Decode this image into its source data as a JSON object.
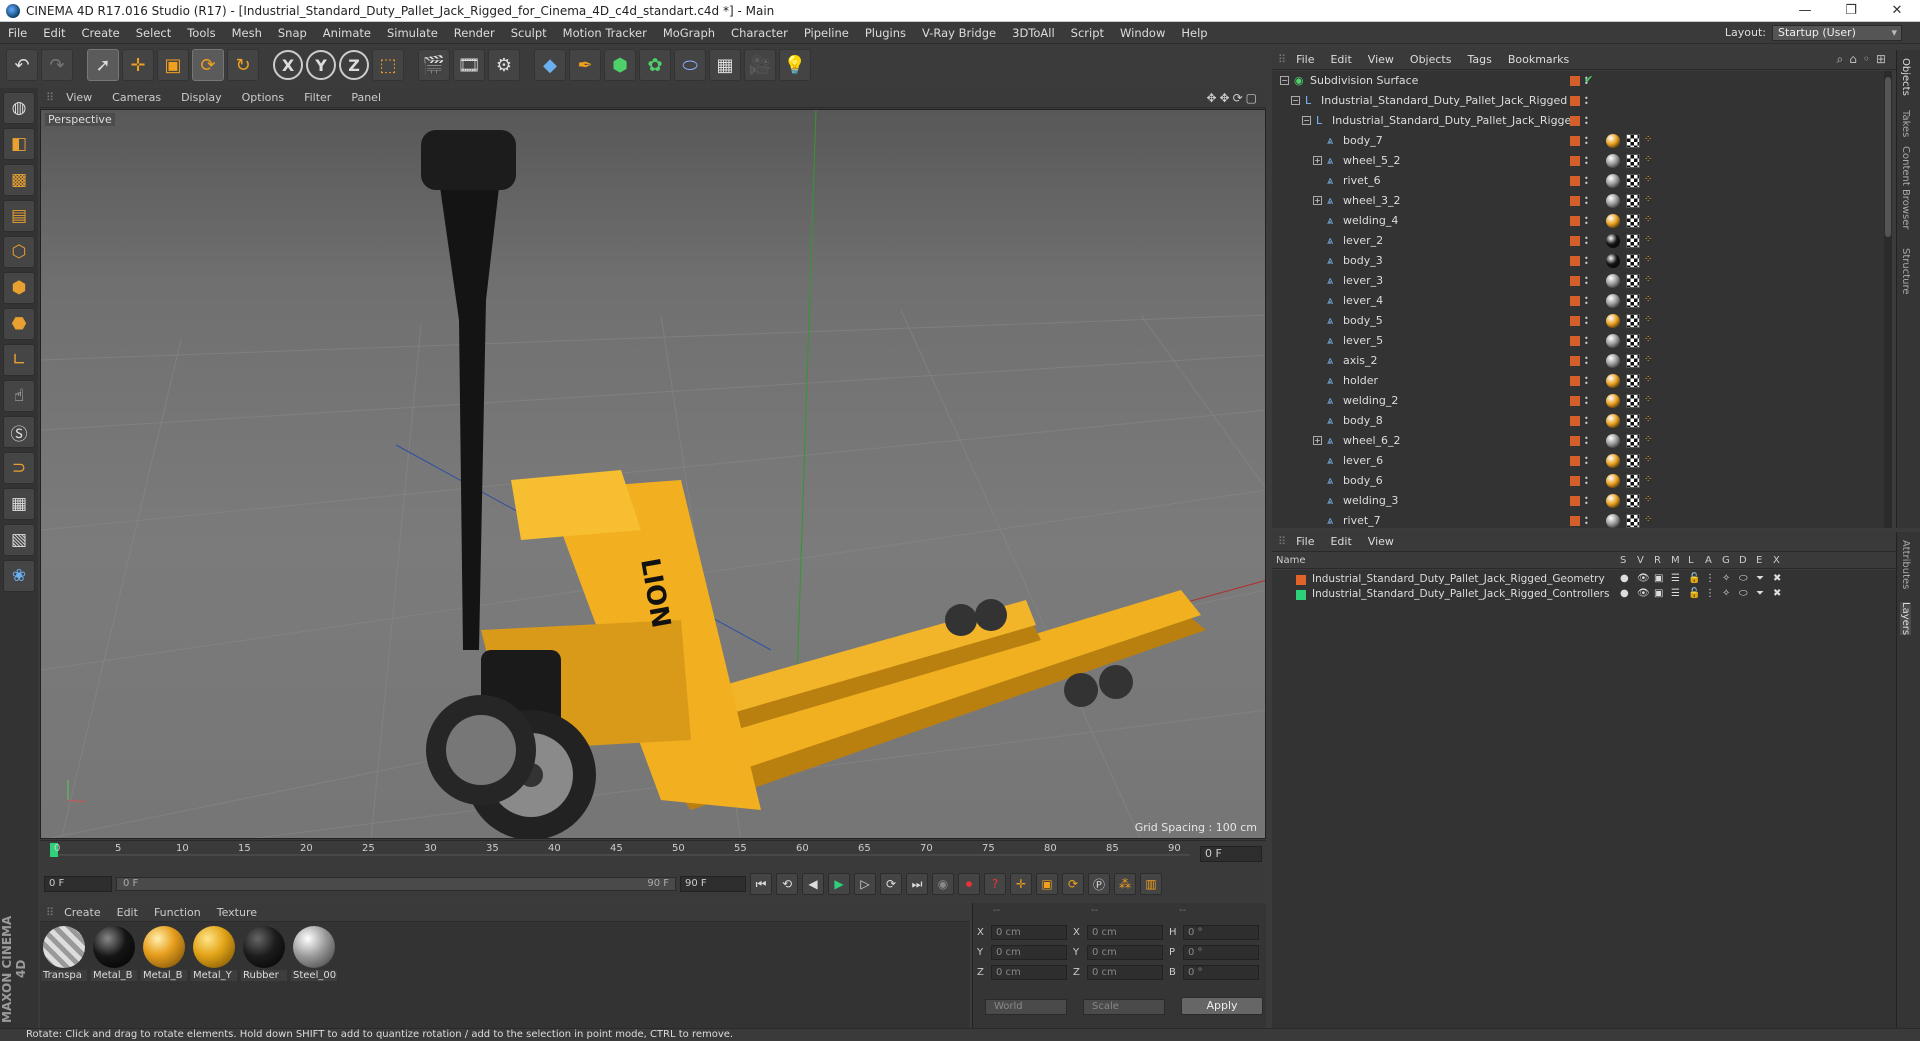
{
  "window": {
    "title": "CINEMA 4D R17.016 Studio (R17) - [Industrial_Standard_Duty_Pallet_Jack_Rigged_for_Cinema_4D_c4d_standart.c4d *] - Main",
    "minimize": "—",
    "maximize": "❐",
    "close": "✕"
  },
  "menu": {
    "items": [
      "File",
      "Edit",
      "Create",
      "Select",
      "Tools",
      "Mesh",
      "Snap",
      "Animate",
      "Simulate",
      "Render",
      "Sculpt",
      "Motion Tracker",
      "MoGraph",
      "Character",
      "Pipeline",
      "Plugins",
      "V-Ray Bridge",
      "3DToAll",
      "Script",
      "Window",
      "Help"
    ],
    "layout_label": "Layout:",
    "layout_value": "Startup (User)"
  },
  "toolbar": {
    "axis_x": "X",
    "axis_y": "Y",
    "axis_z": "Z"
  },
  "viewport": {
    "menu": [
      "View",
      "Cameras",
      "Display",
      "Options",
      "Filter",
      "Panel"
    ],
    "camera": "Perspective",
    "grid_spacing": "Grid Spacing : 100 cm",
    "nav_icons": "✥✥⟳▢",
    "model_text": "LION"
  },
  "timeline": {
    "ticks": [
      "0",
      "5",
      "10",
      "15",
      "20",
      "25",
      "30",
      "35",
      "40",
      "45",
      "50",
      "55",
      "60",
      "65",
      "70",
      "75",
      "80",
      "85",
      "90"
    ],
    "current_frame": "0 F"
  },
  "transport": {
    "start": "0 F",
    "slider_start": "0 F",
    "slider_end": "90 F",
    "end": "90 F"
  },
  "materials": {
    "menu": [
      "Create",
      "Edit",
      "Function",
      "Texture"
    ],
    "items": [
      {
        "label": "Transpa",
        "color": "#cfcfcf"
      },
      {
        "label": "Metal_B",
        "color": "#151515"
      },
      {
        "label": "Metal_B",
        "color": "#e8a020"
      },
      {
        "label": "Metal_Y",
        "color": "#e3a418"
      },
      {
        "label": "Rubber",
        "color": "#1c1c1c"
      },
      {
        "label": "Steel_00",
        "color": "#9a9a9a"
      }
    ]
  },
  "coords": {
    "header1": "--",
    "header2": "--",
    "header3": "--",
    "rows": [
      {
        "a1": "X",
        "v1": "0 cm",
        "a2": "X",
        "v2": "0 cm",
        "a3": "H",
        "v3": "0 °"
      },
      {
        "a1": "Y",
        "v1": "0 cm",
        "a2": "Y",
        "v2": "0 cm",
        "a3": "P",
        "v3": "0 °"
      },
      {
        "a1": "Z",
        "v1": "0 cm",
        "a2": "Z",
        "v2": "0 cm",
        "a3": "B",
        "v3": "0 °"
      }
    ],
    "world": "World",
    "scale": "Scale",
    "apply": "Apply"
  },
  "status": "Rotate: Click and drag to rotate elements. Hold down SHIFT to add to quantize rotation / add to the selection in point mode, CTRL to remove.",
  "maxon": "MAXON CINEMA 4D",
  "objects": {
    "menu": [
      "File",
      "Edit",
      "View",
      "Objects",
      "Tags",
      "Bookmarks"
    ],
    "rows": [
      {
        "name": "Subdivision Surface",
        "indent": 0,
        "exp": "-",
        "tag": "check"
      },
      {
        "name": "Industrial_Standard_Duty_Pallet_Jack_Rigged",
        "indent": 1,
        "exp": "-",
        "tag": ""
      },
      {
        "name": "Industrial_Standard_Duty_Pallet_Jack_Rigged",
        "indent": 2,
        "exp": "-",
        "tag": ""
      },
      {
        "name": "body_7",
        "indent": 3,
        "exp": "",
        "mat": "#e8a020"
      },
      {
        "name": "wheel_5_2",
        "indent": 3,
        "exp": "+",
        "mat": "#9a9a9a"
      },
      {
        "name": "rivet_6",
        "indent": 3,
        "exp": "",
        "mat": "#9a9a9a"
      },
      {
        "name": "wheel_3_2",
        "indent": 3,
        "exp": "+",
        "mat": "#9a9a9a"
      },
      {
        "name": "welding_4",
        "indent": 3,
        "exp": "",
        "mat": "#e8a020"
      },
      {
        "name": "lever_2",
        "indent": 3,
        "exp": "",
        "mat": "#151515"
      },
      {
        "name": "body_3",
        "indent": 3,
        "exp": "",
        "mat": "#151515"
      },
      {
        "name": "lever_3",
        "indent": 3,
        "exp": "",
        "mat": "#9a9a9a"
      },
      {
        "name": "lever_4",
        "indent": 3,
        "exp": "",
        "mat": "#9a9a9a"
      },
      {
        "name": "body_5",
        "indent": 3,
        "exp": "",
        "mat": "#e8a020"
      },
      {
        "name": "lever_5",
        "indent": 3,
        "exp": "",
        "mat": "#9a9a9a"
      },
      {
        "name": "axis_2",
        "indent": 3,
        "exp": "",
        "mat": "#9a9a9a"
      },
      {
        "name": "holder",
        "indent": 3,
        "exp": "",
        "mat": "#e8a020"
      },
      {
        "name": "welding_2",
        "indent": 3,
        "exp": "",
        "mat": "#e8a020"
      },
      {
        "name": "body_8",
        "indent": 3,
        "exp": "",
        "mat": "#e8a020"
      },
      {
        "name": "wheel_6_2",
        "indent": 3,
        "exp": "+",
        "mat": "#9a9a9a"
      },
      {
        "name": "lever_6",
        "indent": 3,
        "exp": "",
        "mat": "#e8a020"
      },
      {
        "name": "body_6",
        "indent": 3,
        "exp": "",
        "mat": "#e8a020"
      },
      {
        "name": "welding_3",
        "indent": 3,
        "exp": "",
        "mat": "#e8a020"
      },
      {
        "name": "rivet_7",
        "indent": 3,
        "exp": "",
        "mat": "#9a9a9a"
      }
    ]
  },
  "layers": {
    "menu": [
      "File",
      "Edit",
      "View"
    ],
    "name_header": "Name",
    "cols": [
      "S",
      "V",
      "R",
      "M",
      "L",
      "A",
      "G",
      "D",
      "E",
      "X"
    ],
    "rows": [
      {
        "name": "Industrial_Standard_Duty_Pallet_Jack_Rigged_Geometry",
        "color": "#e0632a"
      },
      {
        "name": "Industrial_Standard_Duty_Pallet_Jack_Rigged_Controllers",
        "color": "#2fd07a"
      }
    ]
  },
  "sidetabs1": [
    "Objects",
    "Takes",
    "Content Browser",
    "Structure"
  ],
  "sidetabs2": [
    "Attributes",
    "Layers"
  ]
}
